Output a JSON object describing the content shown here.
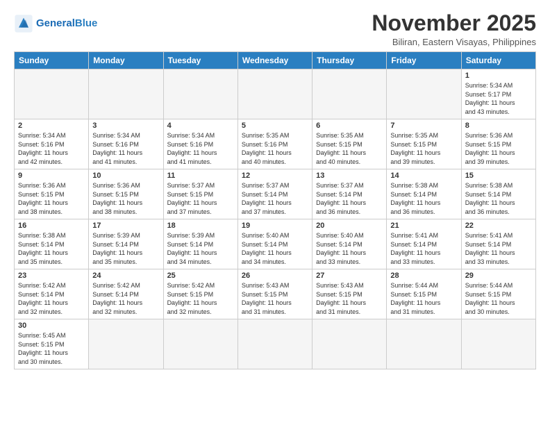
{
  "header": {
    "logo_general": "General",
    "logo_blue": "Blue",
    "month_title": "November 2025",
    "location": "Biliran, Eastern Visayas, Philippines"
  },
  "weekdays": [
    "Sunday",
    "Monday",
    "Tuesday",
    "Wednesday",
    "Thursday",
    "Friday",
    "Saturday"
  ],
  "weeks": [
    [
      {
        "day": "",
        "info": ""
      },
      {
        "day": "",
        "info": ""
      },
      {
        "day": "",
        "info": ""
      },
      {
        "day": "",
        "info": ""
      },
      {
        "day": "",
        "info": ""
      },
      {
        "day": "",
        "info": ""
      },
      {
        "day": "1",
        "info": "Sunrise: 5:34 AM\nSunset: 5:17 PM\nDaylight: 11 hours\nand 43 minutes."
      }
    ],
    [
      {
        "day": "2",
        "info": "Sunrise: 5:34 AM\nSunset: 5:16 PM\nDaylight: 11 hours\nand 42 minutes."
      },
      {
        "day": "3",
        "info": "Sunrise: 5:34 AM\nSunset: 5:16 PM\nDaylight: 11 hours\nand 41 minutes."
      },
      {
        "day": "4",
        "info": "Sunrise: 5:34 AM\nSunset: 5:16 PM\nDaylight: 11 hours\nand 41 minutes."
      },
      {
        "day": "5",
        "info": "Sunrise: 5:35 AM\nSunset: 5:16 PM\nDaylight: 11 hours\nand 40 minutes."
      },
      {
        "day": "6",
        "info": "Sunrise: 5:35 AM\nSunset: 5:15 PM\nDaylight: 11 hours\nand 40 minutes."
      },
      {
        "day": "7",
        "info": "Sunrise: 5:35 AM\nSunset: 5:15 PM\nDaylight: 11 hours\nand 39 minutes."
      },
      {
        "day": "8",
        "info": "Sunrise: 5:36 AM\nSunset: 5:15 PM\nDaylight: 11 hours\nand 39 minutes."
      }
    ],
    [
      {
        "day": "9",
        "info": "Sunrise: 5:36 AM\nSunset: 5:15 PM\nDaylight: 11 hours\nand 38 minutes."
      },
      {
        "day": "10",
        "info": "Sunrise: 5:36 AM\nSunset: 5:15 PM\nDaylight: 11 hours\nand 38 minutes."
      },
      {
        "day": "11",
        "info": "Sunrise: 5:37 AM\nSunset: 5:15 PM\nDaylight: 11 hours\nand 37 minutes."
      },
      {
        "day": "12",
        "info": "Sunrise: 5:37 AM\nSunset: 5:14 PM\nDaylight: 11 hours\nand 37 minutes."
      },
      {
        "day": "13",
        "info": "Sunrise: 5:37 AM\nSunset: 5:14 PM\nDaylight: 11 hours\nand 36 minutes."
      },
      {
        "day": "14",
        "info": "Sunrise: 5:38 AM\nSunset: 5:14 PM\nDaylight: 11 hours\nand 36 minutes."
      },
      {
        "day": "15",
        "info": "Sunrise: 5:38 AM\nSunset: 5:14 PM\nDaylight: 11 hours\nand 36 minutes."
      }
    ],
    [
      {
        "day": "16",
        "info": "Sunrise: 5:38 AM\nSunset: 5:14 PM\nDaylight: 11 hours\nand 35 minutes."
      },
      {
        "day": "17",
        "info": "Sunrise: 5:39 AM\nSunset: 5:14 PM\nDaylight: 11 hours\nand 35 minutes."
      },
      {
        "day": "18",
        "info": "Sunrise: 5:39 AM\nSunset: 5:14 PM\nDaylight: 11 hours\nand 34 minutes."
      },
      {
        "day": "19",
        "info": "Sunrise: 5:40 AM\nSunset: 5:14 PM\nDaylight: 11 hours\nand 34 minutes."
      },
      {
        "day": "20",
        "info": "Sunrise: 5:40 AM\nSunset: 5:14 PM\nDaylight: 11 hours\nand 33 minutes."
      },
      {
        "day": "21",
        "info": "Sunrise: 5:41 AM\nSunset: 5:14 PM\nDaylight: 11 hours\nand 33 minutes."
      },
      {
        "day": "22",
        "info": "Sunrise: 5:41 AM\nSunset: 5:14 PM\nDaylight: 11 hours\nand 33 minutes."
      }
    ],
    [
      {
        "day": "23",
        "info": "Sunrise: 5:42 AM\nSunset: 5:14 PM\nDaylight: 11 hours\nand 32 minutes."
      },
      {
        "day": "24",
        "info": "Sunrise: 5:42 AM\nSunset: 5:14 PM\nDaylight: 11 hours\nand 32 minutes."
      },
      {
        "day": "25",
        "info": "Sunrise: 5:42 AM\nSunset: 5:15 PM\nDaylight: 11 hours\nand 32 minutes."
      },
      {
        "day": "26",
        "info": "Sunrise: 5:43 AM\nSunset: 5:15 PM\nDaylight: 11 hours\nand 31 minutes."
      },
      {
        "day": "27",
        "info": "Sunrise: 5:43 AM\nSunset: 5:15 PM\nDaylight: 11 hours\nand 31 minutes."
      },
      {
        "day": "28",
        "info": "Sunrise: 5:44 AM\nSunset: 5:15 PM\nDaylight: 11 hours\nand 31 minutes."
      },
      {
        "day": "29",
        "info": "Sunrise: 5:44 AM\nSunset: 5:15 PM\nDaylight: 11 hours\nand 30 minutes."
      }
    ],
    [
      {
        "day": "30",
        "info": "Sunrise: 5:45 AM\nSunset: 5:15 PM\nDaylight: 11 hours\nand 30 minutes."
      },
      {
        "day": "",
        "info": ""
      },
      {
        "day": "",
        "info": ""
      },
      {
        "day": "",
        "info": ""
      },
      {
        "day": "",
        "info": ""
      },
      {
        "day": "",
        "info": ""
      },
      {
        "day": "",
        "info": ""
      }
    ]
  ]
}
